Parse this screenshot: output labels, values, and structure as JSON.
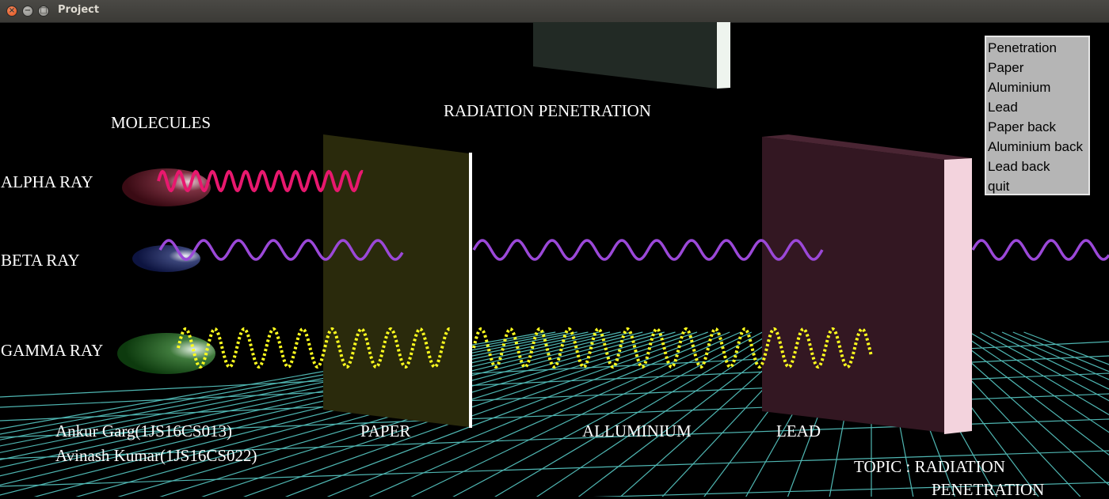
{
  "window": {
    "title": "Project",
    "close_glyph": "×",
    "minimize_glyph": "−",
    "maximize_glyph": "□"
  },
  "scene": {
    "heading": "RADIATION PENETRATION",
    "molecules_label": "MOLECULES",
    "rays": {
      "alpha": {
        "label": "ALPHA RAY",
        "color": "#e8186e"
      },
      "beta": {
        "label": "BETA RAY",
        "color": "#9b48d8"
      },
      "gamma": {
        "label": "GAMMA RAY",
        "color": "#ffff1e"
      }
    },
    "barriers": {
      "paper": "PAPER",
      "aluminium": "ALLUMINIUM",
      "lead": "LEAD"
    },
    "authors": [
      "Ankur Garg(1JS16CS013)",
      "Avinash Kumar(1JS16CS022)"
    ],
    "topic_line1": "TOPIC : RADIATION",
    "topic_line2": "PENETRATION",
    "colors": {
      "background": "#000000",
      "grid": "#4fb6b2",
      "paper_face": "#2a2a0c",
      "lead_face": "#331722",
      "lead_edge": "#f3d3dd",
      "aluminium_face": "#222a25"
    }
  },
  "menu": {
    "items": [
      "Penetration",
      "Paper",
      "Aluminium",
      "Lead",
      "Paper back",
      "Aluminium back",
      "Lead back",
      "quit"
    ]
  }
}
